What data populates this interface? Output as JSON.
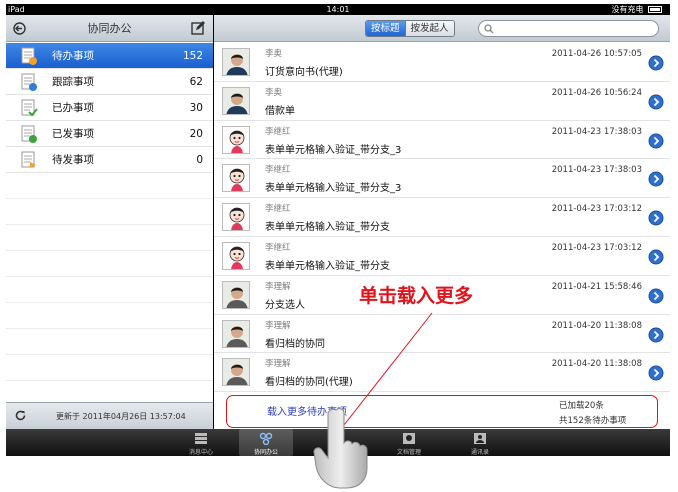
{
  "status_bar": {
    "device": "iPad",
    "time": "14:01",
    "battery": "没有充电"
  },
  "left_nav": {
    "title": "协同办公"
  },
  "menu": [
    {
      "label": "待办事项",
      "count": "152",
      "icon": "pending-doc-icon"
    },
    {
      "label": "跟踪事项",
      "count": "62",
      "icon": "tracking-doc-icon"
    },
    {
      "label": "已办事项",
      "count": "30",
      "icon": "done-doc-icon"
    },
    {
      "label": "已发事项",
      "count": "20",
      "icon": "sent-doc-icon"
    },
    {
      "label": "待发事项",
      "count": "0",
      "icon": "draft-doc-icon"
    }
  ],
  "left_footer": {
    "updated": "更新于 2011年04月26日 13:57:04"
  },
  "segments": {
    "by_title": "按标题",
    "by_sender": "按发起人"
  },
  "search": {
    "placeholder": ""
  },
  "items": [
    {
      "sender": "李奥",
      "subject": "订货意向书(代理)",
      "date": "2011-04-26 10:57:05",
      "avatar": "male"
    },
    {
      "sender": "李奥",
      "subject": "借款单",
      "date": "2011-04-26 10:56:24",
      "avatar": "male"
    },
    {
      "sender": "李继红",
      "subject": "表单单元格输入验证_带分支_3",
      "date": "2011-04-23 17:38:03",
      "avatar": "cartoon"
    },
    {
      "sender": "李继红",
      "subject": "表单单元格输入验证_带分支_3",
      "date": "2011-04-23 17:38:03",
      "avatar": "cartoon"
    },
    {
      "sender": "李继红",
      "subject": "表单单元格输入验证_带分支",
      "date": "2011-04-23 17:03:12",
      "avatar": "cartoon"
    },
    {
      "sender": "李继红",
      "subject": "表单单元格输入验证_带分支",
      "date": "2011-04-23 17:03:12",
      "avatar": "cartoon"
    },
    {
      "sender": "李理解",
      "subject": "分支选人",
      "date": "2011-04-21 15:58:46",
      "avatar": "male2"
    },
    {
      "sender": "李理解",
      "subject": "看归档的协同",
      "date": "2011-04-20 11:38:08",
      "avatar": "male2"
    },
    {
      "sender": "李理解",
      "subject": "看归档的协同(代理)",
      "date": "2011-04-20 11:38:08",
      "avatar": "male2"
    }
  ],
  "load_more": {
    "label": "载入更多待办事项",
    "loaded": "已加载20条",
    "total": "共152条待办事项"
  },
  "annotation": "单击载入更多",
  "tabs": [
    {
      "label": "消息中心",
      "icon": "message-center-icon"
    },
    {
      "label": "协同办公",
      "icon": "collaboration-icon"
    },
    {
      "label": "文档管理",
      "icon": "document-management-icon"
    },
    {
      "label": "通讯录",
      "icon": "address-book-icon"
    }
  ],
  "colors": {
    "accent": "#1a5fcf",
    "annotation": "#e0141b",
    "link": "#2c3db4"
  }
}
